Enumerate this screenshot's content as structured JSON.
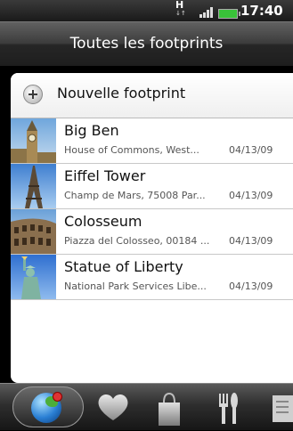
{
  "status_bar": {
    "network": "H",
    "time": "17:40"
  },
  "header": {
    "title": "Toutes les footprints"
  },
  "new_item": {
    "label": "Nouvelle footprint"
  },
  "items": [
    {
      "title": "Big Ben",
      "address": "House of Commons, West...",
      "date": "04/13/09"
    },
    {
      "title": "Eiffel Tower",
      "address": "Champ de Mars, 75008 Par...",
      "date": "04/13/09"
    },
    {
      "title": "Colosseum",
      "address": "Piazza del Colosseo, 00184 ...",
      "date": "04/13/09"
    },
    {
      "title": "Statue of Liberty",
      "address": "National Park Services Libe...",
      "date": "04/13/09"
    }
  ],
  "tabs": [
    {
      "icon": "globe-icon",
      "selected": true
    },
    {
      "icon": "heart-icon",
      "selected": false
    },
    {
      "icon": "shopping-bag-icon",
      "selected": false
    },
    {
      "icon": "fork-knife-icon",
      "selected": false
    },
    {
      "icon": "receipt-icon",
      "selected": false
    }
  ],
  "colors": {
    "accent_battery": "#39c239",
    "list_background": "#ffffff"
  }
}
